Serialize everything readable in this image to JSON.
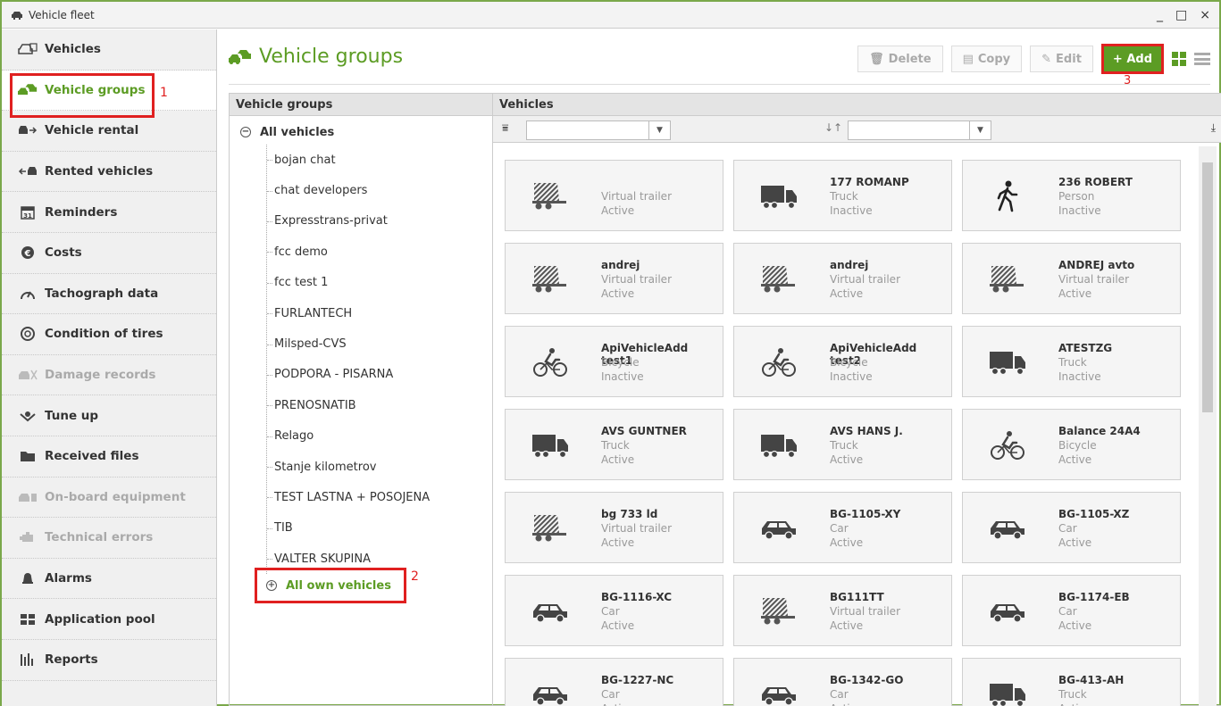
{
  "window": {
    "title": "Vehicle fleet",
    "minimize": "_",
    "maximize": "□",
    "close": "×"
  },
  "sidebar": {
    "items": [
      {
        "label": "Vehicles",
        "icon": "car-list-icon",
        "state": "normal"
      },
      {
        "label": "Vehicle groups",
        "icon": "vehicle-groups-icon",
        "state": "active"
      },
      {
        "label": "Vehicle rental",
        "icon": "vehicle-rental-icon",
        "state": "normal"
      },
      {
        "label": "Rented vehicles",
        "icon": "rented-vehicles-icon",
        "state": "normal"
      },
      {
        "label": "Reminders",
        "icon": "calendar-icon",
        "state": "normal"
      },
      {
        "label": "Costs",
        "icon": "euro-icon",
        "state": "normal"
      },
      {
        "label": "Tachograph data",
        "icon": "gauge-icon",
        "state": "normal"
      },
      {
        "label": "Condition of tires",
        "icon": "tire-icon",
        "state": "normal"
      },
      {
        "label": "Damage records",
        "icon": "damage-icon",
        "state": "disabled"
      },
      {
        "label": "Tune up",
        "icon": "tune-up-icon",
        "state": "normal"
      },
      {
        "label": "Received files",
        "icon": "folder-icon",
        "state": "normal"
      },
      {
        "label": "On-board equipment",
        "icon": "onboard-equipment-icon",
        "state": "disabled"
      },
      {
        "label": "Technical errors",
        "icon": "engine-icon",
        "state": "disabled"
      },
      {
        "label": "Alarms",
        "icon": "bell-icon",
        "state": "normal"
      },
      {
        "label": "Application pool",
        "icon": "apps-icon",
        "state": "normal"
      },
      {
        "label": "Reports",
        "icon": "reports-icon",
        "state": "normal"
      }
    ]
  },
  "annotations": {
    "a1": "1",
    "a2": "2",
    "a3": "3"
  },
  "header": {
    "title": "Vehicle groups",
    "delete_label": "Delete",
    "copy_label": "Copy",
    "edit_label": "Edit",
    "add_label": "+ Add"
  },
  "groups_pane": {
    "heading": "Vehicle groups",
    "root": "All vehicles",
    "root_toggle": "−",
    "groups": [
      "bojan chat",
      "chat developers",
      "Expresstrans-privat",
      "fcc demo",
      "fcc test 1",
      "FURLANTECH",
      "Milsped-CVS",
      "PODPORA - PISARNA",
      "PRENOSNATIB",
      "Relago",
      "Stanje kilometrov",
      "TEST LASTNA + POSOJENA",
      "TIB",
      "VALTER SKUPINA"
    ],
    "own": "All own vehicles",
    "own_toggle": "+"
  },
  "vehicles_pane": {
    "heading": "Vehicles",
    "filter_value": "",
    "sort_value": ""
  },
  "vehicles": [
    {
      "name": "",
      "type": "Virtual trailer",
      "status": "Active",
      "icon": "trailer"
    },
    {
      "name": "177 ROMANP",
      "type": "Truck",
      "status": "Inactive",
      "icon": "truck"
    },
    {
      "name": "236 ROBERT",
      "type": "Person",
      "status": "Inactive",
      "icon": "person"
    },
    {
      "name": "andrej",
      "type": "Virtual trailer",
      "status": "Active",
      "icon": "trailer"
    },
    {
      "name": "andrej",
      "type": "Virtual trailer",
      "status": "Active",
      "icon": "trailer"
    },
    {
      "name": "ANDREJ avto",
      "type": "Virtual trailer",
      "status": "Active",
      "icon": "trailer"
    },
    {
      "name": "ApiVehicleAdd test1",
      "type": "Bicycle",
      "status": "Inactive",
      "icon": "bicycle"
    },
    {
      "name": "ApiVehicleAdd test2",
      "type": "Bicycle",
      "status": "Inactive",
      "icon": "bicycle"
    },
    {
      "name": "ATESTZG",
      "type": "Truck",
      "status": "Inactive",
      "icon": "truck"
    },
    {
      "name": "AVS GUNTNER",
      "type": "Truck",
      "status": "Active",
      "icon": "truck"
    },
    {
      "name": "AVS HANS J.",
      "type": "Truck",
      "status": "Active",
      "icon": "truck"
    },
    {
      "name": "Balance 24A4",
      "type": "Bicycle",
      "status": "Active",
      "icon": "bicycle"
    },
    {
      "name": "bg 733 ld",
      "type": "Virtual trailer",
      "status": "Active",
      "icon": "trailer"
    },
    {
      "name": "BG-1105-XY",
      "type": "Car",
      "status": "Active",
      "icon": "car"
    },
    {
      "name": "BG-1105-XZ",
      "type": "Car",
      "status": "Active",
      "icon": "car"
    },
    {
      "name": "BG-1116-XC",
      "type": "Car",
      "status": "Active",
      "icon": "car"
    },
    {
      "name": "BG111TT",
      "type": "Virtual trailer",
      "status": "Active",
      "icon": "trailer"
    },
    {
      "name": "BG-1174-EB",
      "type": "Car",
      "status": "Active",
      "icon": "car"
    },
    {
      "name": "BG-1227-NC",
      "type": "Car",
      "status": "Active",
      "icon": "car"
    },
    {
      "name": "BG-1342-GO",
      "type": "Car",
      "status": "Active",
      "icon": "car"
    },
    {
      "name": "BG-413-AH",
      "type": "Truck",
      "status": "Active",
      "icon": "truck"
    }
  ]
}
